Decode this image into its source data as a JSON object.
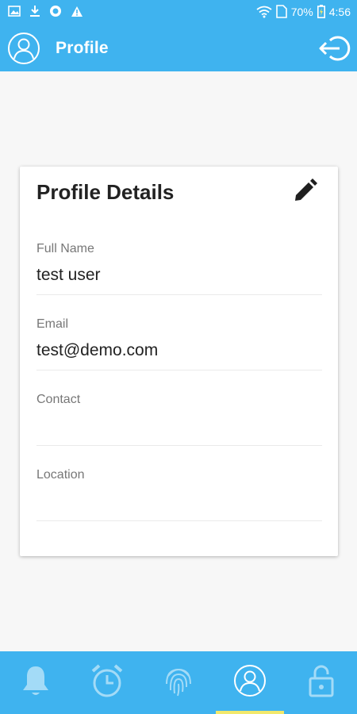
{
  "status_bar": {
    "battery": "70%",
    "time": "4:56",
    "left_icons": [
      "image-icon",
      "download-icon",
      "circle-app-icon",
      "warning-icon"
    ],
    "right_icons": [
      "wifi-icon",
      "sim-icon",
      "battery-charging-icon"
    ]
  },
  "app_bar": {
    "title": "Profile",
    "left_icon": "user-avatar-icon",
    "right_icon": "logout-icon"
  },
  "card": {
    "title": "Profile Details",
    "edit_icon": "pencil-icon",
    "fields": [
      {
        "label": "Full Name",
        "value": "test user"
      },
      {
        "label": "Email",
        "value": "test@demo.com"
      },
      {
        "label": "Contact",
        "value": ""
      },
      {
        "label": "Location",
        "value": ""
      }
    ]
  },
  "bottom_nav": {
    "items": [
      {
        "icon": "bell-icon",
        "active": false
      },
      {
        "icon": "alarm-clock-icon",
        "active": false
      },
      {
        "icon": "fingerprint-icon",
        "active": false
      },
      {
        "icon": "profile-icon",
        "active": true
      },
      {
        "icon": "lock-icon",
        "active": false
      }
    ]
  },
  "colors": {
    "primary": "#3fb3ef",
    "active_indicator": "#f2e86b",
    "background": "#f7f7f7",
    "card": "#ffffff"
  }
}
